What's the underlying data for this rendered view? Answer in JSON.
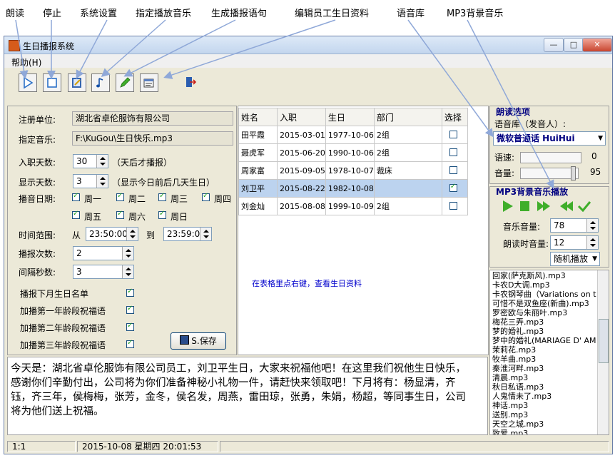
{
  "annotations": [
    "朗读",
    "停止",
    "系统设置",
    "指定播放音乐",
    "生成播报语句",
    "编辑员工生日资料",
    "语音库",
    "MP3背景音乐"
  ],
  "window": {
    "title": "生日播报系统",
    "menu_help": "帮助(H)",
    "min": "—",
    "max": "□",
    "close": "✕"
  },
  "toolbar": {
    "icons": [
      "play-icon",
      "stop-icon",
      "settings-icon",
      "music-note-icon",
      "pencil-icon",
      "edit-data-icon",
      "exit-icon"
    ]
  },
  "form": {
    "reg_unit_label": "注册单位:",
    "reg_unit_value": "湖北省卓伦服饰有限公司",
    "music_label": "指定音乐:",
    "music_value": "F:\\KuGou\\生日快乐.mp3",
    "days_label": "入职天数:",
    "days_value": "30",
    "days_note": "（天后才播报）",
    "show_label": "显示天数:",
    "show_value": "3",
    "show_note": "（显示今日前后几天生日）",
    "date_label": "播音日期:",
    "weekdays": [
      {
        "label": "周一",
        "checked": true
      },
      {
        "label": "周二",
        "checked": true
      },
      {
        "label": "周三",
        "checked": true
      },
      {
        "label": "周四",
        "checked": true
      },
      {
        "label": "周五",
        "checked": true
      },
      {
        "label": "周六",
        "checked": true
      },
      {
        "label": "周日",
        "checked": true
      }
    ],
    "time_label": "时间范围:",
    "from_label": "从",
    "from_value": "23:50:00",
    "to_label": "到",
    "to_value": "23:59:00",
    "count_label": "播报次数:",
    "count_value": "2",
    "interval_label": "间隔秒数:",
    "interval_value": "3",
    "options": [
      {
        "label": "播报下月生日名单",
        "checked": true
      },
      {
        "label": "加播第一年龄段祝福语",
        "checked": true
      },
      {
        "label": "加播第二年龄段祝福语",
        "checked": true
      },
      {
        "label": "加播第三年龄段祝福语",
        "checked": true
      }
    ],
    "save_label": "S.保存"
  },
  "table": {
    "headers": [
      "姓名",
      "入职",
      "生日",
      "部门",
      "选择"
    ],
    "rows": [
      {
        "name": "田平霞",
        "join": "2015-03-01",
        "birth": "1977-10-06",
        "dept": "2组",
        "checked": false,
        "selected": false
      },
      {
        "name": "聂虎军",
        "join": "2015-06-20",
        "birth": "1990-10-06",
        "dept": "2组",
        "checked": false,
        "selected": false
      },
      {
        "name": "周家富",
        "join": "2015-09-05",
        "birth": "1978-10-07",
        "dept": "裁床",
        "checked": false,
        "selected": false
      },
      {
        "name": "刘卫平",
        "join": "2015-08-22",
        "birth": "1982-10-08",
        "dept": "",
        "checked": true,
        "selected": true
      },
      {
        "name": "刘金灿",
        "join": "2015-08-08",
        "birth": "1999-10-09",
        "dept": "2组",
        "checked": false,
        "selected": false
      }
    ],
    "hint": "在表格里点右键，查看生日资料",
    "hint_color": "#0000cc"
  },
  "reading": {
    "title": "朗读选项",
    "lib_label": "语音库（发音人）:",
    "voice": "微软普通话 HuiHui",
    "speed_label": "语速:",
    "speed_value": "0",
    "volume_label": "音量:",
    "volume_value": "95",
    "volume_level": 0.95
  },
  "mp3": {
    "title": "MP3背景音乐播放",
    "music_vol_label": "音乐音量:",
    "music_vol_value": "78",
    "read_vol_label": "朗读时音量:",
    "read_vol_value": "12",
    "mode": "随机播放"
  },
  "playlist": [
    "回家(萨克斯风).mp3",
    "卡农D大调.mp3",
    "卡农钢琴曲（Variations on th",
    "可惜不是双鱼座(新曲).mp3",
    "罗密欧与朱丽叶.mp3",
    "梅花三弄.mp3",
    "梦的婚礼.mp3",
    "梦中的婚礼(MARIAGE D' AM",
    "茉莉花.mp3",
    "牧羊曲.mp3",
    "秦淮河畔.mp3",
    "清晨.mp3",
    "秋日私语.mp3",
    "人鬼情未了.mp3",
    "神话.mp3",
    "送别.mp3",
    "天空之城.mp3",
    "致爱.mp3"
  ],
  "message": "今天是：湖北省卓伦服饰有限公司员工，刘卫平生日，大家来祝福他吧！在这里我们祝他生日快乐，感谢你们辛勤付出，公司将为你们准备神秘小礼物一件，请赶快来领取吧！下月将有：杨显清，齐钰，齐三年，侯梅梅，张芳，金冬，侯名发，周燕，雷田琼，张勇，朱娟，杨超，等同事生日，公司将为他们送上祝福。",
  "status": {
    "pos": "1:1",
    "datetime": "2015-10-08 星期四 20:01:53"
  },
  "colors": {
    "accent": "#000080",
    "selected_row": "#bcd3ef",
    "green": "#2a9d2a"
  }
}
